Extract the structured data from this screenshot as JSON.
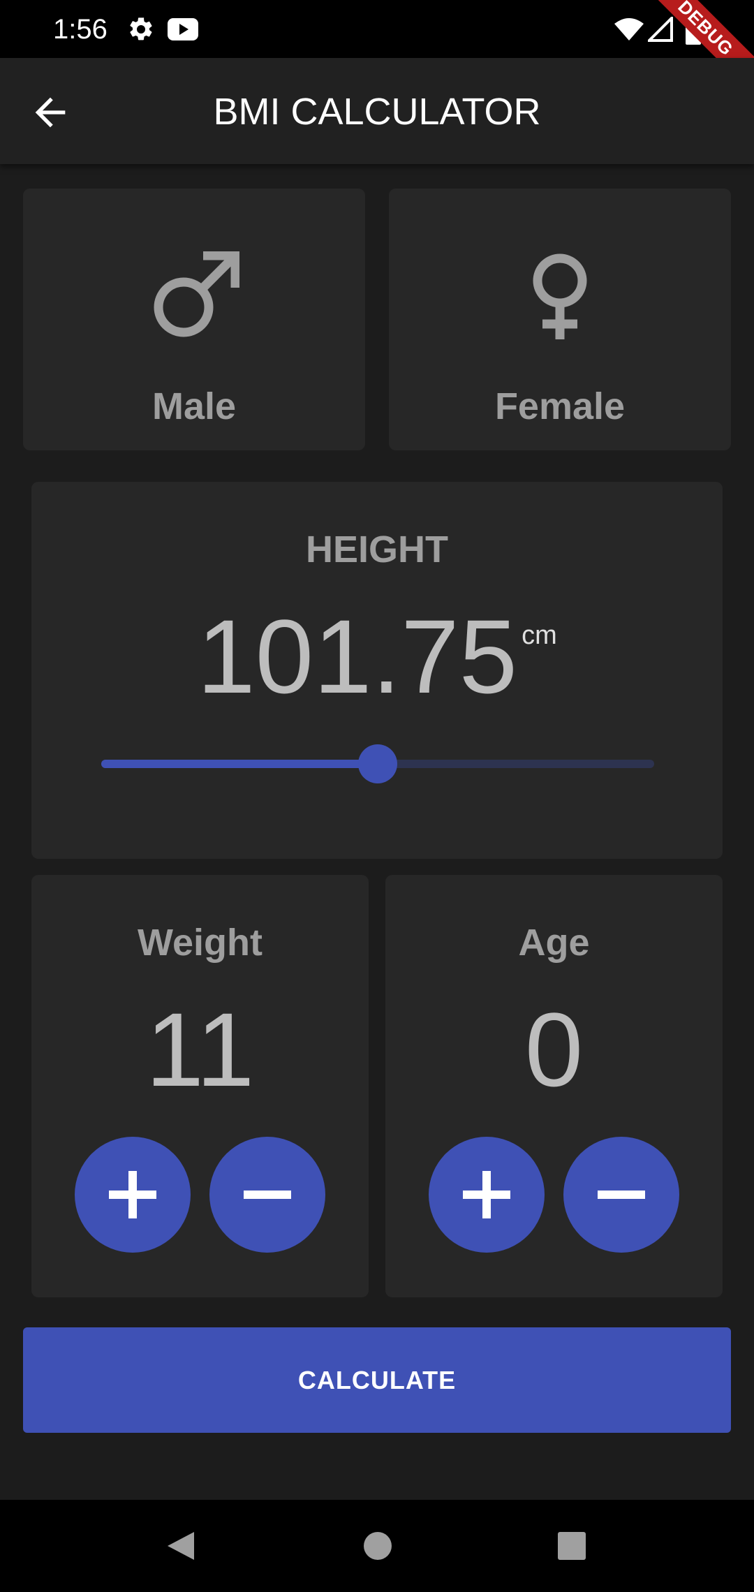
{
  "status_bar": {
    "time": "1:56",
    "icons": [
      "settings-icon",
      "youtube-icon",
      "wifi-icon",
      "signal-icon",
      "battery-icon"
    ],
    "debug_banner": "DEBUG"
  },
  "app_bar": {
    "title": "BMI CALCULATOR",
    "back_icon": "arrow-back-icon"
  },
  "gender": {
    "male": {
      "label": "Male",
      "icon": "male-icon"
    },
    "female": {
      "label": "Female",
      "icon": "female-icon"
    }
  },
  "height": {
    "label": "HEIGHT",
    "value": "101.75",
    "unit": "cm",
    "slider_fraction": 0.5
  },
  "weight": {
    "label": "Weight",
    "value": "11",
    "plus_icon": "plus-icon",
    "minus_icon": "minus-icon"
  },
  "age": {
    "label": "Age",
    "value": "0",
    "plus_icon": "plus-icon",
    "minus_icon": "minus-icon"
  },
  "calculate_label": "CALCULATE",
  "nav": {
    "icons": [
      "back-triangle-icon",
      "home-circle-icon",
      "recents-square-icon"
    ]
  },
  "colors": {
    "accent": "#3f51b5",
    "card": "#272727",
    "background": "#1c1c1c",
    "app_bar": "#212121",
    "label_gray": "#9e9e9e"
  }
}
